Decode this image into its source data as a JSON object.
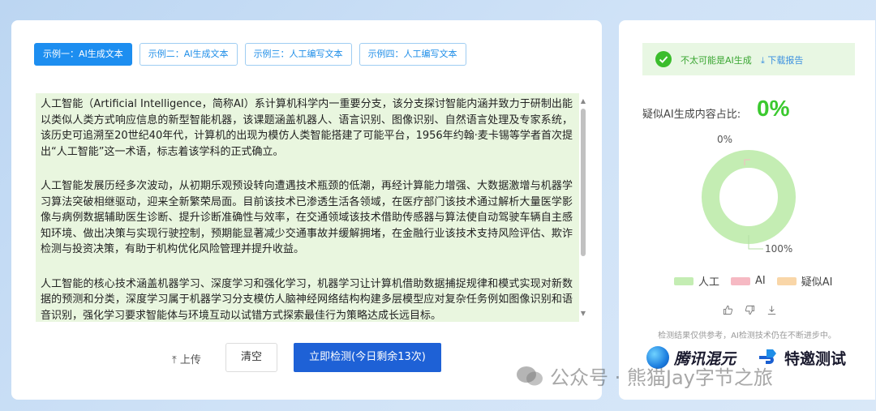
{
  "tabs": [
    {
      "label": "示例一：AI生成文本",
      "active": true
    },
    {
      "label": "示例二：AI生成文本",
      "active": false
    },
    {
      "label": "示例三：人工编写文本",
      "active": false
    },
    {
      "label": "示例四：人工编写文本",
      "active": false
    }
  ],
  "text": {
    "paragraphs": [
      "人工智能（Artificial Intelligence，简称AI）系计算机科学内一重要分支，该分支探讨智能内涵并致力于研制出能以类似人类方式响应信息的新型智能机器，该课题涵盖机器人、语言识别、图像识别、自然语言处理及专家系统，该历史可追溯至20世纪40年代，计算机的出现为模仿人类智能搭建了可能平台，1956年约翰·麦卡锡等学者首次提出“人工智能”这一术语，标志着该学科的正式确立。",
      "人工智能发展历经多次波动，从初期乐观预设转向遭遇技术瓶颈的低潮，再经计算能力增强、大数据激增与机器学习算法突破相继驱动，迎来全新繁荣局面。目前该技术已渗透生活各领域，在医疗部门该技术通过解析大量医学影像与病例数据辅助医生诊断、提升诊断准确性与效率，在交通领域该技术借助传感器与算法使自动驾驶车辆自主感知环境、做出决策与实现行驶控制，预期能显著减少交通事故并缓解拥堵，在金融行业该技术支持风险评估、欺诈检测与投资决策，有助于机构优化风险管理并提升收益。",
      "人工智能的核心技术涵盖机器学习、深度学习和强化学习，机器学习让计算机借助数据捕捉规律和模式实现对新数据的预测和分类，深度学习属于机器学习分支模仿人脑神经网络结构构建多层模型应对复杂任务例如图像识别和语音识别，强化学习要求智能体与环境互动以试错方式探索最佳行为策略达成长远目标。"
    ]
  },
  "actions": {
    "upload_label": "上传",
    "clear_label": "清空",
    "detect_label": "立即检测(今日剩余13次)"
  },
  "result": {
    "status_text": "不太可能是AI生成",
    "download_label": "下载报告",
    "ratio_label": "疑似AI生成内容占比:",
    "ratio_value": "0%",
    "donut": {
      "label_top": "0%",
      "label_bottom": "100%",
      "slices": [
        {
          "name": "人工",
          "value": 100,
          "color": "#c4edb3"
        },
        {
          "name": "AI",
          "value": 0,
          "color": "#f6b9c3"
        },
        {
          "name": "疑似AI",
          "value": 0,
          "color": "#f9d6a8"
        }
      ]
    },
    "disclaimer": "检测结果仅供参考，AI检测技术仍在不断进步中。"
  },
  "brands": {
    "hunyuan": "腾讯混元",
    "special": "特邀测试"
  },
  "watermark": "公众号 · 熊猫Jay字节之旅",
  "colors": {
    "accent": "#1d8ef0",
    "primary_button": "#1e61d6",
    "human": "#c4edb3",
    "ai": "#f6b9c3",
    "suspected_ai": "#f9d6a8",
    "ok_green": "#3bc92f"
  }
}
